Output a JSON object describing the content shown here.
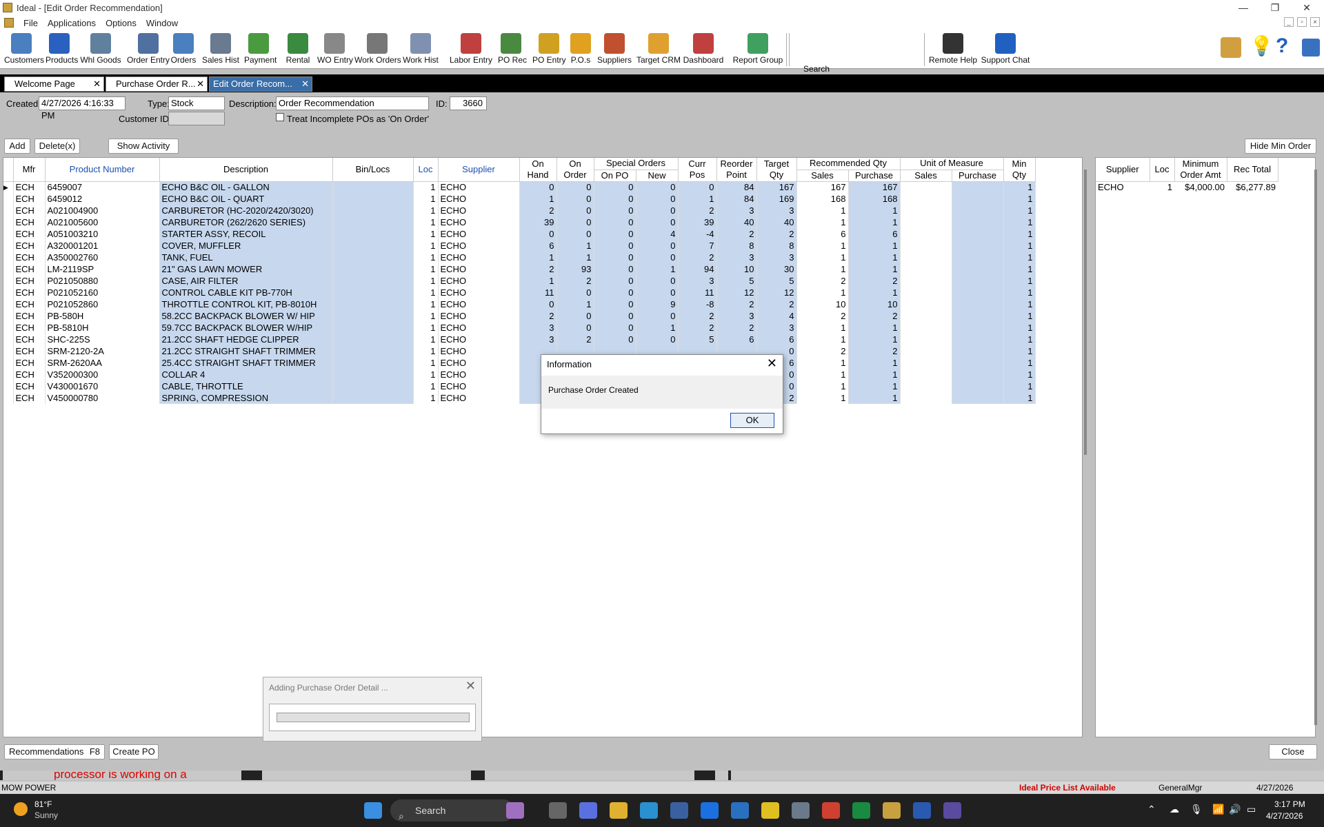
{
  "window": {
    "title": "Ideal - [Edit Order Recommendation]",
    "minimize": "—",
    "restore": "❐",
    "close": "✕"
  },
  "menu": [
    "File",
    "Applications",
    "Options",
    "Window"
  ],
  "toolbar": [
    {
      "label": "Customers",
      "icon": "customers-icon",
      "color": "#4a7fc0"
    },
    {
      "label": "Products",
      "icon": "products-icon",
      "color": "#2a60c0"
    },
    {
      "label": "Whl Goods",
      "icon": "gauge-icon",
      "color": "#6080a0"
    },
    {
      "label": "Order Entry",
      "icon": "order-entry-icon",
      "color": "#5070a0"
    },
    {
      "label": "Orders",
      "icon": "orders-icon",
      "color": "#4a7fc0"
    },
    {
      "label": "Sales Hist",
      "icon": "sales-hist-icon",
      "color": "#6a7a90"
    },
    {
      "label": "Payment",
      "icon": "payment-icon",
      "color": "#4a9a40"
    },
    {
      "label": "Rental",
      "icon": "rental-icon",
      "color": "#3a8a40"
    },
    {
      "label": "WO Entry",
      "icon": "wrench-icon",
      "color": "#888888"
    },
    {
      "label": "Work Orders",
      "icon": "tools-icon",
      "color": "#777777"
    },
    {
      "label": "Work Hist",
      "icon": "clock-icon",
      "color": "#8090b0"
    },
    {
      "label": "Labor Entry",
      "icon": "labor-icon",
      "color": "#c04040"
    },
    {
      "label": "PO Rec",
      "icon": "po-rec-icon",
      "color": "#4a8a40"
    },
    {
      "label": "PO Entry",
      "icon": "po-entry-icon",
      "color": "#d0a020"
    },
    {
      "label": "P.O.s",
      "icon": "pos-icon",
      "color": "#e0a020"
    },
    {
      "label": "Suppliers",
      "icon": "suppliers-icon",
      "color": "#c05030"
    },
    {
      "label": "Target CRM",
      "icon": "target-icon",
      "color": "#e0a030"
    },
    {
      "label": "Dashboard",
      "icon": "dashboard-icon",
      "color": "#c04040"
    },
    {
      "label": "Report Group",
      "icon": "report-icon",
      "color": "#40a060"
    },
    {
      "label": "Remote Help",
      "icon": "remote-icon",
      "color": "#333333"
    },
    {
      "label": "Support Chat",
      "icon": "chat-icon",
      "color": "#2060c0"
    }
  ],
  "search": {
    "label": "Search",
    "value": "",
    "go": "▶"
  },
  "tabs": [
    {
      "label": "Welcome Page",
      "close": "✕"
    },
    {
      "label": "Purchase Order R...",
      "close": "✕"
    },
    {
      "label": "Edit Order Recom...",
      "close": "✕"
    }
  ],
  "form": {
    "created_label": "Created:",
    "created_value": "4/27/2026 4:16:33 PM",
    "type_label": "Type:",
    "type_value": "Stock",
    "description_label": "Description:",
    "description_value": "Order Recommendation",
    "id_label": "ID:",
    "id_value": "3660",
    "customer_label": "Customer ID:",
    "customer_value": "",
    "incomplete_label": "Treat Incomplete POs as 'On Order'"
  },
  "buttons": {
    "add": "Add",
    "delete": "Delete(x)",
    "show_activity": "Show Activity",
    "hide_min": "Hide Min Order",
    "recommendations": "Recommendations",
    "recommendations_key": "F8",
    "create_po": "Create PO",
    "close": "Close"
  },
  "grid": {
    "group_headers": {
      "special": "Special Orders",
      "recommended": "Recommended Qty",
      "uom": "Unit of Measure"
    },
    "columns": {
      "mfr": "Mfr",
      "product": "Product Number",
      "description": "Description",
      "bin": "Bin/Locs",
      "loc": "Loc",
      "supplier": "Supplier",
      "onhand": "On\nHand",
      "onorder": "On\nOrder",
      "onpo": "On PO",
      "new": "New",
      "currpos": "Curr\nPos",
      "reorder": "Reorder\nPoint",
      "target": "Target\nQty",
      "sales": "Sales",
      "purchase": "Purchase",
      "uom_sales": "Sales",
      "uom_purchase": "Purchase",
      "minqty": "Min\nQty"
    },
    "rows": [
      [
        "ECH",
        "6459007",
        "ECHO B&C OIL - GALLON",
        "",
        "1",
        "ECHO",
        "0",
        "0",
        "0",
        "0",
        "0",
        "84",
        "167",
        "167",
        "167",
        "",
        "",
        "1"
      ],
      [
        "ECH",
        "6459012",
        "ECHO B&C OIL - QUART",
        "",
        "1",
        "ECHO",
        "1",
        "0",
        "0",
        "0",
        "1",
        "84",
        "169",
        "168",
        "168",
        "",
        "",
        "1"
      ],
      [
        "ECH",
        "A021004900",
        "CARBURETOR (HC-2020/2420/3020)",
        "",
        "1",
        "ECHO",
        "2",
        "0",
        "0",
        "0",
        "2",
        "3",
        "3",
        "1",
        "1",
        "",
        "",
        "1"
      ],
      [
        "ECH",
        "A021005600",
        "CARBURETOR (262/2620 SERIES)",
        "",
        "1",
        "ECHO",
        "39",
        "0",
        "0",
        "0",
        "39",
        "40",
        "40",
        "1",
        "1",
        "",
        "",
        "1"
      ],
      [
        "ECH",
        "A051003210",
        "STARTER ASSY, RECOIL",
        "",
        "1",
        "ECHO",
        "0",
        "0",
        "0",
        "4",
        "-4",
        "2",
        "2",
        "6",
        "6",
        "",
        "",
        "1"
      ],
      [
        "ECH",
        "A320001201",
        "COVER, MUFFLER",
        "",
        "1",
        "ECHO",
        "6",
        "1",
        "0",
        "0",
        "7",
        "8",
        "8",
        "1",
        "1",
        "",
        "",
        "1"
      ],
      [
        "ECH",
        "A350002760",
        "TANK, FUEL",
        "",
        "1",
        "ECHO",
        "1",
        "1",
        "0",
        "0",
        "2",
        "3",
        "3",
        "1",
        "1",
        "",
        "",
        "1"
      ],
      [
        "ECH",
        "LM-2119SP",
        "21\" GAS LAWN MOWER",
        "",
        "1",
        "ECHO",
        "2",
        "93",
        "0",
        "1",
        "94",
        "10",
        "30",
        "1",
        "1",
        "",
        "",
        "1"
      ],
      [
        "ECH",
        "P021050880",
        "CASE, AIR FILTER",
        "",
        "1",
        "ECHO",
        "1",
        "2",
        "0",
        "0",
        "3",
        "5",
        "5",
        "2",
        "2",
        "",
        "",
        "1"
      ],
      [
        "ECH",
        "P021052160",
        "CONTROL CABLE KIT PB-770H",
        "",
        "1",
        "ECHO",
        "11",
        "0",
        "0",
        "0",
        "11",
        "12",
        "12",
        "1",
        "1",
        "",
        "",
        "1"
      ],
      [
        "ECH",
        "P021052860",
        "THROTTLE CONTROL KIT, PB-8010H",
        "",
        "1",
        "ECHO",
        "0",
        "1",
        "0",
        "9",
        "-8",
        "2",
        "2",
        "10",
        "10",
        "",
        "",
        "1"
      ],
      [
        "ECH",
        "PB-580H",
        "58.2CC BACKPACK BLOWER W/ HIP",
        "",
        "1",
        "ECHO",
        "2",
        "0",
        "0",
        "0",
        "2",
        "3",
        "4",
        "2",
        "2",
        "",
        "",
        "1"
      ],
      [
        "ECH",
        "PB-5810H",
        "59.7CC BACKPACK BLOWER W/HIP",
        "",
        "1",
        "ECHO",
        "3",
        "0",
        "0",
        "1",
        "2",
        "2",
        "3",
        "1",
        "1",
        "",
        "",
        "1"
      ],
      [
        "ECH",
        "SHC-225S",
        "21.2CC SHAFT HEDGE CLIPPER",
        "",
        "1",
        "ECHO",
        "3",
        "2",
        "0",
        "0",
        "5",
        "6",
        "6",
        "1",
        "1",
        "",
        "",
        "1"
      ],
      [
        "ECH",
        "SRM-2120-2A",
        "21.2CC STRAIGHT SHAFT TRIMMER",
        "",
        "1",
        "ECHO",
        "",
        "",
        "",
        "",
        "",
        "",
        "0",
        "2",
        "2",
        "",
        "",
        "1"
      ],
      [
        "ECH",
        "SRM-2620AA",
        "25.4CC STRAIGHT SHAFT TRIMMER",
        "",
        "1",
        "ECHO",
        "",
        "",
        "",
        "",
        "",
        "",
        "6",
        "1",
        "1",
        "",
        "",
        "1"
      ],
      [
        "ECH",
        "V352000300",
        "COLLAR 4",
        "",
        "1",
        "ECHO",
        "",
        "",
        "",
        "",
        "",
        "",
        "0",
        "1",
        "1",
        "",
        "",
        "1"
      ],
      [
        "ECH",
        "V430001670",
        "CABLE, THROTTLE",
        "",
        "1",
        "ECHO",
        "",
        "",
        "",
        "",
        "",
        "",
        "0",
        "1",
        "1",
        "",
        "",
        "1"
      ],
      [
        "ECH",
        "V450000780",
        "SPRING, COMPRESSION",
        "",
        "1",
        "ECHO",
        "",
        "",
        "",
        "",
        "",
        "",
        "2",
        "1",
        "1",
        "",
        "",
        "1"
      ]
    ]
  },
  "summary": {
    "columns": {
      "supplier": "Supplier",
      "loc": "Loc",
      "min": "Minimum\nOrder Amt",
      "rec": "Rec Total"
    },
    "rows": [
      [
        "ECHO",
        "1",
        "$4,000.00",
        "$6,277.89"
      ]
    ]
  },
  "dialog": {
    "title": "Information",
    "message": "Purchase Order Created",
    "ok": "OK",
    "close": "✕"
  },
  "progress": {
    "title": "Adding Purchase Order Detail ...",
    "close": "✕",
    "fill_fraction": 0
  },
  "ticker": {
    "text": "processor is working on a"
  },
  "status": {
    "left": "MOW POWER",
    "price_list": "Ideal Price List Available",
    "user": "GeneralMgr",
    "date": "4/27/2026"
  },
  "taskbar": {
    "weather_temp": "81°F",
    "weather_desc": "Sunny",
    "search": "Search",
    "time": "3:17 PM",
    "date": "4/27/2026"
  },
  "colors": {
    "selected_tab": "#3a6ea8",
    "highlight_cell": "#c7d8ee",
    "header_blue": "#1a4fb0",
    "price_list_red": "#d00000"
  }
}
